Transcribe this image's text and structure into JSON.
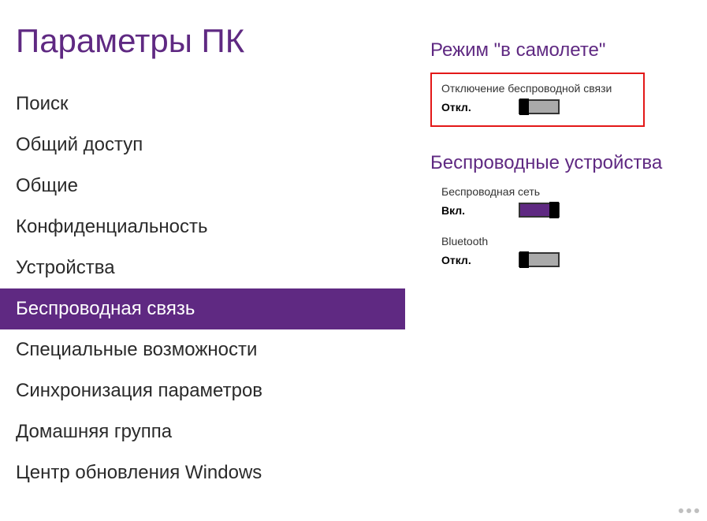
{
  "sidebar": {
    "title": "Параметры ПК",
    "items": [
      {
        "label": "Поиск",
        "active": false
      },
      {
        "label": "Общий доступ",
        "active": false
      },
      {
        "label": "Общие",
        "active": false
      },
      {
        "label": "Конфиденциальность",
        "active": false
      },
      {
        "label": "Устройства",
        "active": false
      },
      {
        "label": "Беспроводная связь",
        "active": true
      },
      {
        "label": "Специальные возможности",
        "active": false
      },
      {
        "label": "Синхронизация параметров",
        "active": false
      },
      {
        "label": "Домашняя группа",
        "active": false
      },
      {
        "label": "Центр обновления Windows",
        "active": false
      }
    ]
  },
  "content": {
    "airplane": {
      "title": "Режим \"в самолете\"",
      "label": "Отключение беспроводной связи",
      "status": "Откл.",
      "on": false
    },
    "wireless": {
      "title": "Беспроводные устройства",
      "wifi": {
        "label": "Беспроводная сеть",
        "status": "Вкл.",
        "on": true
      },
      "bluetooth": {
        "label": "Bluetooth",
        "status": "Откл.",
        "on": false
      }
    }
  }
}
